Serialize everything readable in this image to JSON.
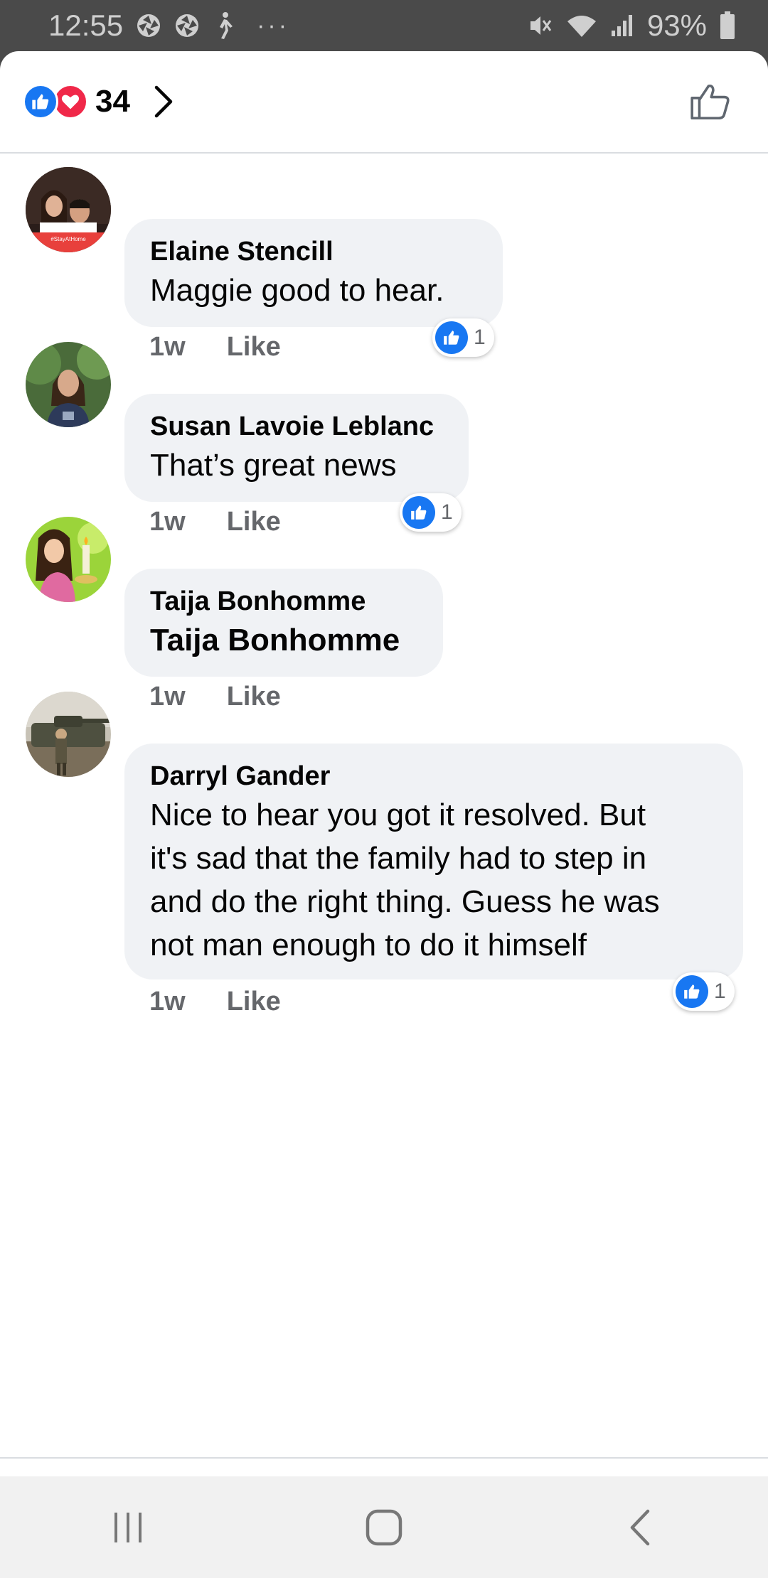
{
  "status_bar": {
    "time": "12:55",
    "battery": "93%",
    "icons": [
      "aperture-icon",
      "aperture-icon",
      "walking-icon",
      "more-dots-icon",
      "mute-icon",
      "wifi-icon",
      "signal-icon",
      "battery-icon"
    ],
    "dots": "···"
  },
  "header": {
    "reaction_count": "34",
    "reaction_icons": [
      "like-icon",
      "love-icon"
    ]
  },
  "comments": [
    {
      "author": "Elaine Stencill",
      "text": "Maggie good to hear.",
      "time": "1w",
      "like_label": "Like",
      "reaction_count": "1"
    },
    {
      "author": "Susan Lavoie Leblanc",
      "text": "That’s great news",
      "time": "1w",
      "like_label": "Like",
      "reaction_count": "1"
    },
    {
      "author": "Taija Bonhomme",
      "text": "Taija Bonhomme",
      "time": "1w",
      "like_label": "Like"
    },
    {
      "author": "Darryl Gander",
      "text_lines": [
        "Nice to hear you got it resolved. But",
        "it's sad that the family had to step in",
        "and do the right thing. Guess he was",
        "not man enough to do it himself"
      ],
      "time": "1w",
      "like_label": "Like",
      "reaction_count": "1"
    }
  ],
  "colors": {
    "like_blue": "#1877f2",
    "love_red": "#f02849",
    "bubble_bg": "#f0f2f5",
    "meta_gray": "#65676b"
  }
}
